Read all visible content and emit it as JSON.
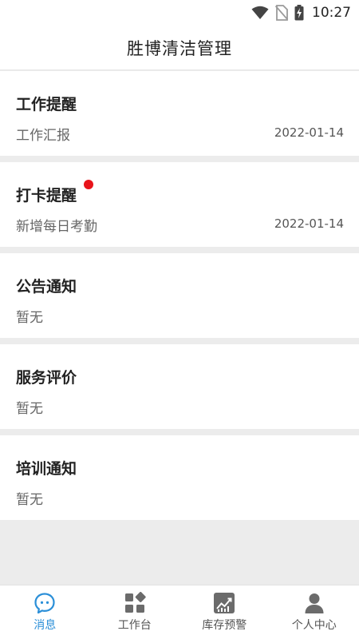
{
  "status_bar": {
    "time": "10:27"
  },
  "header": {
    "title": "胜博清洁管理"
  },
  "cards": [
    {
      "title": "工作提醒",
      "subtitle": "工作汇报",
      "date": "2022-01-14"
    },
    {
      "title": "打卡提醒",
      "subtitle": "新增每日考勤",
      "date": "2022-01-14",
      "unread": true
    },
    {
      "title": "公告通知",
      "subtitle": "暂无"
    },
    {
      "title": "服务评价",
      "subtitle": "暂无"
    },
    {
      "title": "培训通知",
      "subtitle": "暂无"
    }
  ],
  "tab_bar": {
    "tabs": [
      {
        "label": "消息",
        "icon": "chat-bubble-icon",
        "active": true
      },
      {
        "label": "工作台",
        "icon": "workbench-grid-icon"
      },
      {
        "label": "库存预警",
        "icon": "stock-chart-icon"
      },
      {
        "label": "个人中心",
        "icon": "user-icon"
      }
    ]
  },
  "colors": {
    "accent": "#2b8fd8",
    "unread_dot": "#e8141b",
    "icon_gray": "#6b6b6b"
  }
}
